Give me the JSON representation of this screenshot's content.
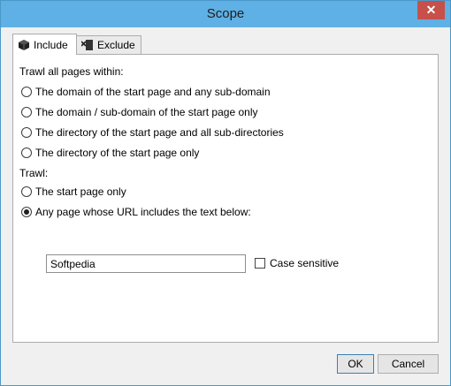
{
  "window": {
    "title": "Scope",
    "close_glyph": "✕"
  },
  "tabs": [
    {
      "label": "Include",
      "icon": "cube-icon",
      "active": true
    },
    {
      "label": "Exclude",
      "icon": "exclude-icon",
      "active": false
    }
  ],
  "include": {
    "within_label": "Trawl all pages within:",
    "within_options": [
      {
        "label": "The domain of the start page and any sub-domain",
        "checked": false
      },
      {
        "label": "The domain / sub-domain of the start page only",
        "checked": false
      },
      {
        "label": "The directory of the start page and all sub-directories",
        "checked": false
      },
      {
        "label": "The directory of the start page only",
        "checked": false
      }
    ],
    "trawl_label": "Trawl:",
    "trawl_options": [
      {
        "label": "The start page only",
        "checked": false
      },
      {
        "label": "Any page whose URL includes the text below:",
        "checked": true
      }
    ],
    "url_text_value": "Softpedia",
    "case_sensitive_label": "Case sensitive",
    "case_sensitive_checked": false
  },
  "buttons": {
    "ok": "OK",
    "cancel": "Cancel"
  }
}
